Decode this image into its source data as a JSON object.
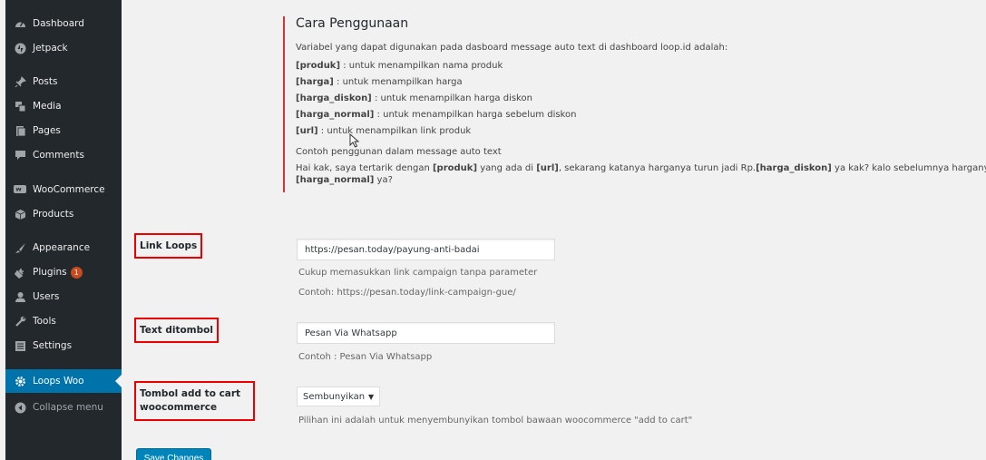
{
  "sidebar": {
    "items": [
      {
        "label": "Dashboard",
        "icon": "dashboard-icon"
      },
      {
        "label": "Jetpack",
        "icon": "jetpack-icon"
      },
      {
        "label": "Posts",
        "icon": "pin-icon"
      },
      {
        "label": "Media",
        "icon": "media-icon"
      },
      {
        "label": "Pages",
        "icon": "pages-icon"
      },
      {
        "label": "Comments",
        "icon": "comments-icon"
      },
      {
        "label": "WooCommerce",
        "icon": "woocommerce-icon"
      },
      {
        "label": "Products",
        "icon": "products-icon"
      },
      {
        "label": "Appearance",
        "icon": "appearance-icon"
      },
      {
        "label": "Plugins",
        "icon": "plugins-icon",
        "badge": "1"
      },
      {
        "label": "Users",
        "icon": "users-icon"
      },
      {
        "label": "Tools",
        "icon": "tools-icon"
      },
      {
        "label": "Settings",
        "icon": "settings-icon"
      },
      {
        "label": "Loops Woo",
        "icon": "gear-icon",
        "active": true
      },
      {
        "label": "Collapse menu",
        "icon": "collapse-icon"
      }
    ]
  },
  "info": {
    "title": "Cara Penggunaan",
    "intro": "Variabel yang dapat digunakan pada dasboard message auto text di dashboard loop.id adalah:",
    "vars": [
      {
        "key": "[produk]",
        "desc": " : untuk menampilkan nama produk"
      },
      {
        "key": "[harga]",
        "desc": " : untuk menampilkan harga"
      },
      {
        "key": "[harga_diskon]",
        "desc": " : untuk menampilkan harga diskon"
      },
      {
        "key": "[harga_normal]",
        "desc": " : untuk menampilkan harga sebelum diskon"
      },
      {
        "key": "[url]",
        "desc": " : untuk menampilkan link produk"
      }
    ],
    "example_heading": "Contoh penggunan dalam message auto text",
    "example": {
      "t1": "Hai kak, saya tertarik dengan ",
      "k1": "[produk]",
      "t2": " yang ada di ",
      "k2": "[url]",
      "t3": ", sekarang katanya harganya turun jadi Rp.",
      "k3": "[harga_diskon]",
      "t4": " ya kak? kalo sebelumnya harganya Rp.",
      "k4": "[harga_normal]",
      "t5": " ya?"
    }
  },
  "fields": {
    "link_loops": {
      "label": "Link Loops",
      "value": "https://pesan.today/payung-anti-badai",
      "desc1": "Cukup memasukkan link campaign tanpa parameter",
      "desc2": "Contoh: https://pesan.today/link-campaign-gue/"
    },
    "text_button": {
      "label": "Text ditombol",
      "value": "Pesan Via Whatsapp",
      "desc": "Contoh : Pesan Via Whatsapp"
    },
    "add_to_cart": {
      "label_line1": "Tombol add to cart",
      "label_line2": "woocommerce",
      "selected": "Sembunyikan",
      "desc": "Pilihan ini adalah untuk menyembunyikan tombol bawaan woocommerce \"add to cart\""
    }
  },
  "save_label": "Save Changes",
  "colors": {
    "sidebar_bg": "#23282d",
    "active_bg": "#0073aa",
    "highlight_border": "#e00000",
    "info_border": "#dc3232",
    "button_bg": "#0085ba"
  }
}
